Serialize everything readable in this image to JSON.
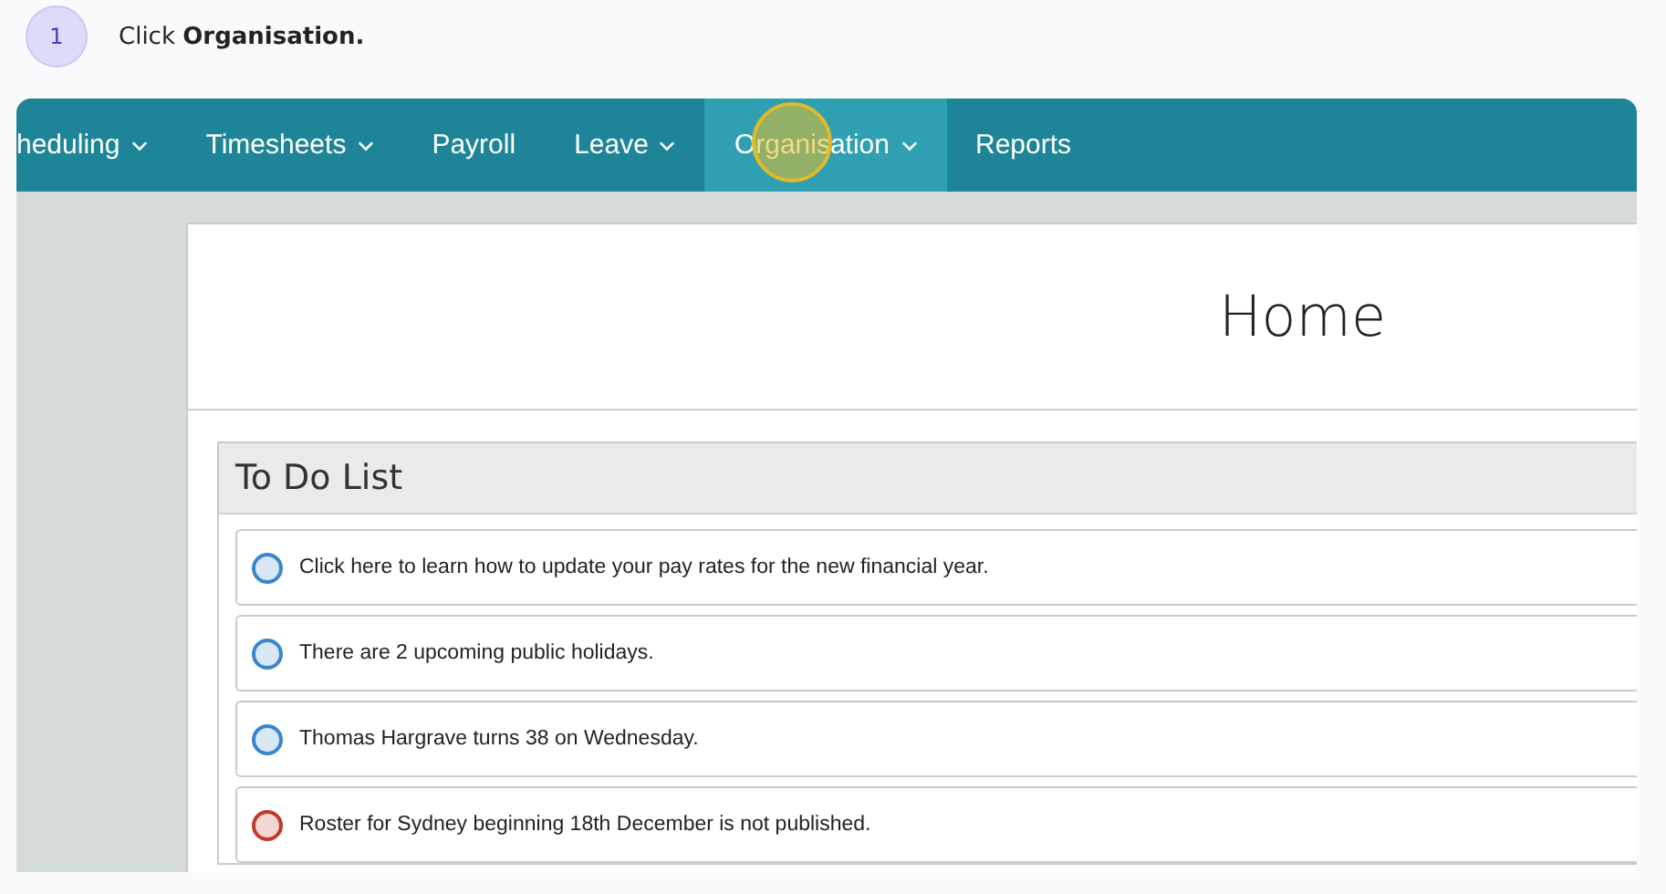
{
  "step": {
    "number": "1",
    "caption": "Click **Organisation.**"
  },
  "nav": {
    "items": [
      {
        "label": "heduling",
        "dropdown": true,
        "selected": false
      },
      {
        "label": "Timesheets",
        "dropdown": true,
        "selected": false
      },
      {
        "label": "Payroll",
        "dropdown": false,
        "selected": false
      },
      {
        "label": "Leave",
        "dropdown": true,
        "selected": false
      },
      {
        "label": "Organisation",
        "dropdown": true,
        "selected": true
      },
      {
        "label": "Reports",
        "dropdown": false,
        "selected": false
      }
    ]
  },
  "page": {
    "title": "Home"
  },
  "todo": {
    "title": "To Do List",
    "items": [
      {
        "text": "Click here to learn how to update your pay rates for the new financial year.",
        "color": "#3b86c9"
      },
      {
        "text": "There are 2 upcoming public holidays.",
        "color": "#3b86c9"
      },
      {
        "text": "Thomas Hargrave turns 38 on Wednesday.",
        "color": "#3b86c9"
      },
      {
        "text": "Roster for Sydney beginning 18th December is not published.",
        "color": "#c0392b"
      }
    ]
  }
}
